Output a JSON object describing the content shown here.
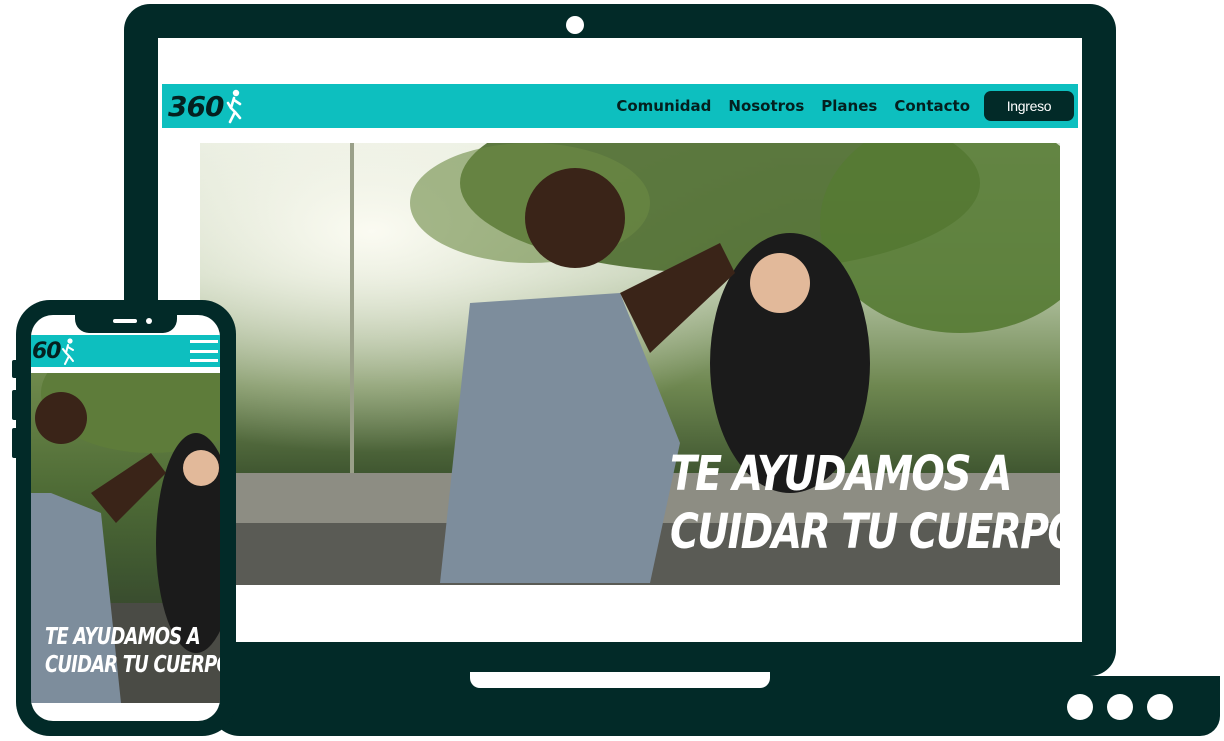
{
  "brand": {
    "logo_text": "360",
    "accent": "#0dbfbf",
    "dark": "#022a28"
  },
  "desktop": {
    "nav": {
      "links": [
        "Comunidad",
        "Nosotros",
        "Planes",
        "Contacto"
      ],
      "login_label": "Ingreso"
    },
    "hero": {
      "line1": "TE AYUDAMOS A",
      "line2": "CUIDAR TU CUERPO"
    }
  },
  "mobile": {
    "nav": {
      "logo_text": "60",
      "menu_icon": "hamburger-icon"
    },
    "hero": {
      "line1": "TE AYUDAMOS A",
      "line2": "CUIDAR TU CUERPO"
    }
  }
}
